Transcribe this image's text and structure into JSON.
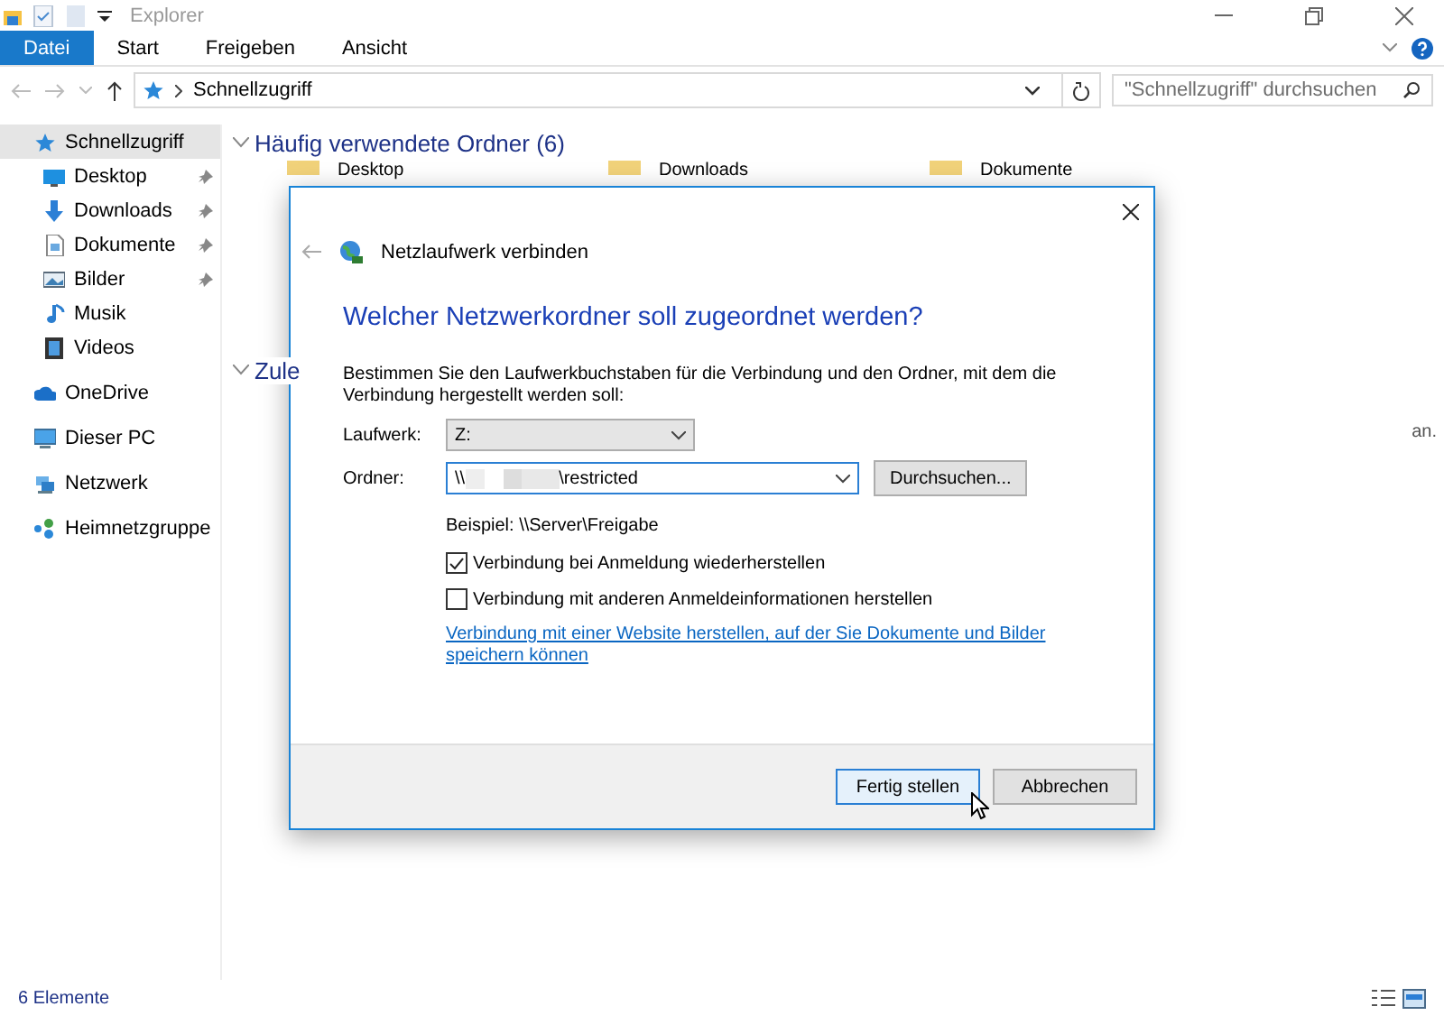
{
  "window": {
    "title": "Explorer"
  },
  "ribbon": {
    "tabs": [
      {
        "label": "Datei",
        "selected": true
      },
      {
        "label": "Start",
        "selected": false
      },
      {
        "label": "Freigeben",
        "selected": false
      },
      {
        "label": "Ansicht",
        "selected": false
      }
    ]
  },
  "address_bar": {
    "path": "Schnellzugriff",
    "search_placeholder": "\"Schnellzugriff\" durchsuchen"
  },
  "sidebar": {
    "items": [
      {
        "label": "Schnellzugriff",
        "selected": true,
        "children": [
          {
            "label": "Desktop",
            "pinned": true
          },
          {
            "label": "Downloads",
            "pinned": true
          },
          {
            "label": "Dokumente",
            "pinned": true
          },
          {
            "label": "Bilder",
            "pinned": true
          },
          {
            "label": "Musik",
            "pinned": false
          },
          {
            "label": "Videos",
            "pinned": false
          }
        ]
      },
      {
        "label": "OneDrive",
        "selected": false
      },
      {
        "label": "Dieser PC",
        "selected": false
      },
      {
        "label": "Netzwerk",
        "selected": false
      },
      {
        "label": "Heimnetzgruppe",
        "selected": false
      }
    ]
  },
  "content": {
    "sections": [
      {
        "title": "Häufig verwendete Ordner (6)",
        "expanded": true,
        "folders": [
          "Desktop",
          "Downloads",
          "Dokumente"
        ]
      },
      {
        "title": "Zule",
        "expanded": true
      }
    ],
    "note": "an."
  },
  "dialog": {
    "title": "Netzlaufwerk verbinden",
    "heading": "Welcher Netzwerkordner soll zugeordnet werden?",
    "description": "Bestimmen Sie den Laufwerkbuchstaben für die Verbindung und den Ordner, mit dem die Verbindung hergestellt werden soll:",
    "drive_label": "Laufwerk:",
    "drive_value": "Z:",
    "folder_label": "Ordner:",
    "folder_prefix": "\\\\",
    "folder_suffix": "\\restricted",
    "browse_button": "Durchsuchen...",
    "example": "Beispiel: \\\\Server\\Freigabe",
    "checkboxes": [
      {
        "label": "Verbindung bei Anmeldung wiederherstellen",
        "checked": true
      },
      {
        "label": "Verbindung mit anderen Anmeldeinformationen herstellen",
        "checked": false
      }
    ],
    "link": "Verbindung mit einer Website herstellen, auf der Sie Dokumente und Bilder speichern können",
    "buttons": [
      {
        "label": "Fertig stellen",
        "default": true
      },
      {
        "label": "Abbrechen",
        "default": false
      }
    ]
  },
  "status_bar": {
    "count": "6 Elemente"
  }
}
